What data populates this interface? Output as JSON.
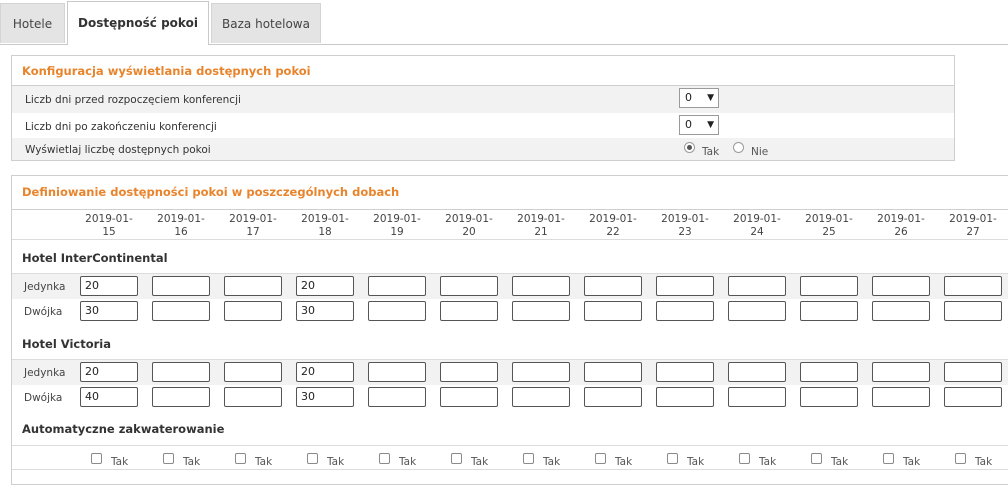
{
  "tabs": [
    {
      "label": "Hotele",
      "active": false
    },
    {
      "label": "Dostępność pokoi",
      "active": true
    },
    {
      "label": "Baza hotelowa",
      "active": false
    }
  ],
  "config": {
    "title": "Konfiguracja wyświetlania dostępnych pokoi",
    "rows": [
      {
        "label": "Liczb dni przed rozpoczęciem konferencji",
        "type": "select",
        "value": "0"
      },
      {
        "label": "Liczb dni po zakończeniu konferencji",
        "type": "select",
        "value": "0"
      },
      {
        "label": "Wyświetlaj liczbę dostępnych pokoi",
        "type": "radio",
        "options": [
          "Tak",
          "Nie"
        ],
        "selected": "Tak"
      }
    ]
  },
  "definitions": {
    "title": "Definiowanie dostępności pokoi w poszczególnych dobach",
    "dates": [
      [
        "2019-01-",
        "15"
      ],
      [
        "2019-01-",
        "16"
      ],
      [
        "2019-01-",
        "17"
      ],
      [
        "2019-01-",
        "18"
      ],
      [
        "2019-01-",
        "19"
      ],
      [
        "2019-01-",
        "20"
      ],
      [
        "2019-01-",
        "21"
      ],
      [
        "2019-01-",
        "22"
      ],
      [
        "2019-01-",
        "23"
      ],
      [
        "2019-01-",
        "24"
      ],
      [
        "2019-01-",
        "25"
      ],
      [
        "2019-01-",
        "26"
      ],
      [
        "2019-01-",
        "27"
      ]
    ],
    "hotels": [
      {
        "name": "Hotel InterContinental",
        "rooms": [
          {
            "label": "Jedynka",
            "values": [
              "20",
              "",
              "",
              "20",
              "",
              "",
              "",
              "",
              "",
              "",
              "",
              "",
              ""
            ]
          },
          {
            "label": "Dwójka",
            "values": [
              "30",
              "",
              "",
              "30",
              "",
              "",
              "",
              "",
              "",
              "",
              "",
              "",
              ""
            ]
          }
        ]
      },
      {
        "name": "Hotel Victoria",
        "rooms": [
          {
            "label": "Jedynka",
            "values": [
              "20",
              "",
              "",
              "20",
              "",
              "",
              "",
              "",
              "",
              "",
              "",
              "",
              ""
            ]
          },
          {
            "label": "Dwójka",
            "values": [
              "40",
              "",
              "",
              "30",
              "",
              "",
              "",
              "",
              "",
              "",
              "",
              "",
              ""
            ]
          }
        ]
      }
    ],
    "auto": {
      "title": "Automatyczne zakwaterowanie",
      "checkbox_label": "Tak"
    }
  }
}
